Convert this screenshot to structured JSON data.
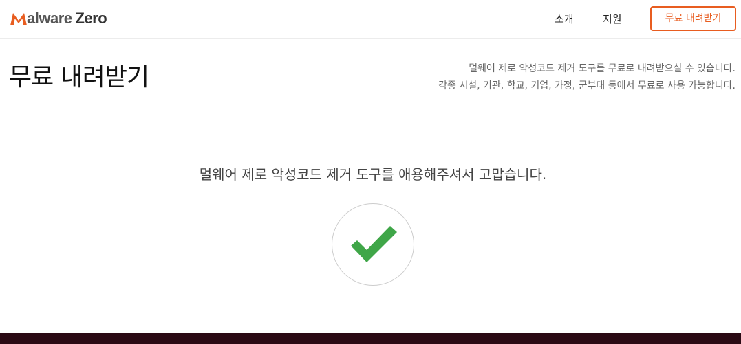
{
  "brand": {
    "logo_initial": "M",
    "logo_word": "alware",
    "logo_word2": "Zero",
    "accent_color": "#e85d20"
  },
  "nav": {
    "about": "소개",
    "support": "지원",
    "download_button": "무료 내려받기"
  },
  "header": {
    "title": "무료 내려받기",
    "description_line1": "멀웨어 제로 악성코드 제거 도구를 무료로 내려받으실 수 있습니다.",
    "description_line2": "각종 시설, 기관, 학교, 기업, 가정, 군부대 등에서 무료로 사용 가능합니다."
  },
  "main": {
    "thanks_message": "멀웨어 제로 악성코드 제거 도구를 애용해주셔서 고맙습니다.",
    "status_icon": "checkmark-icon",
    "check_color": "#3fa648"
  },
  "footer": {
    "color": "#2b0a14"
  }
}
